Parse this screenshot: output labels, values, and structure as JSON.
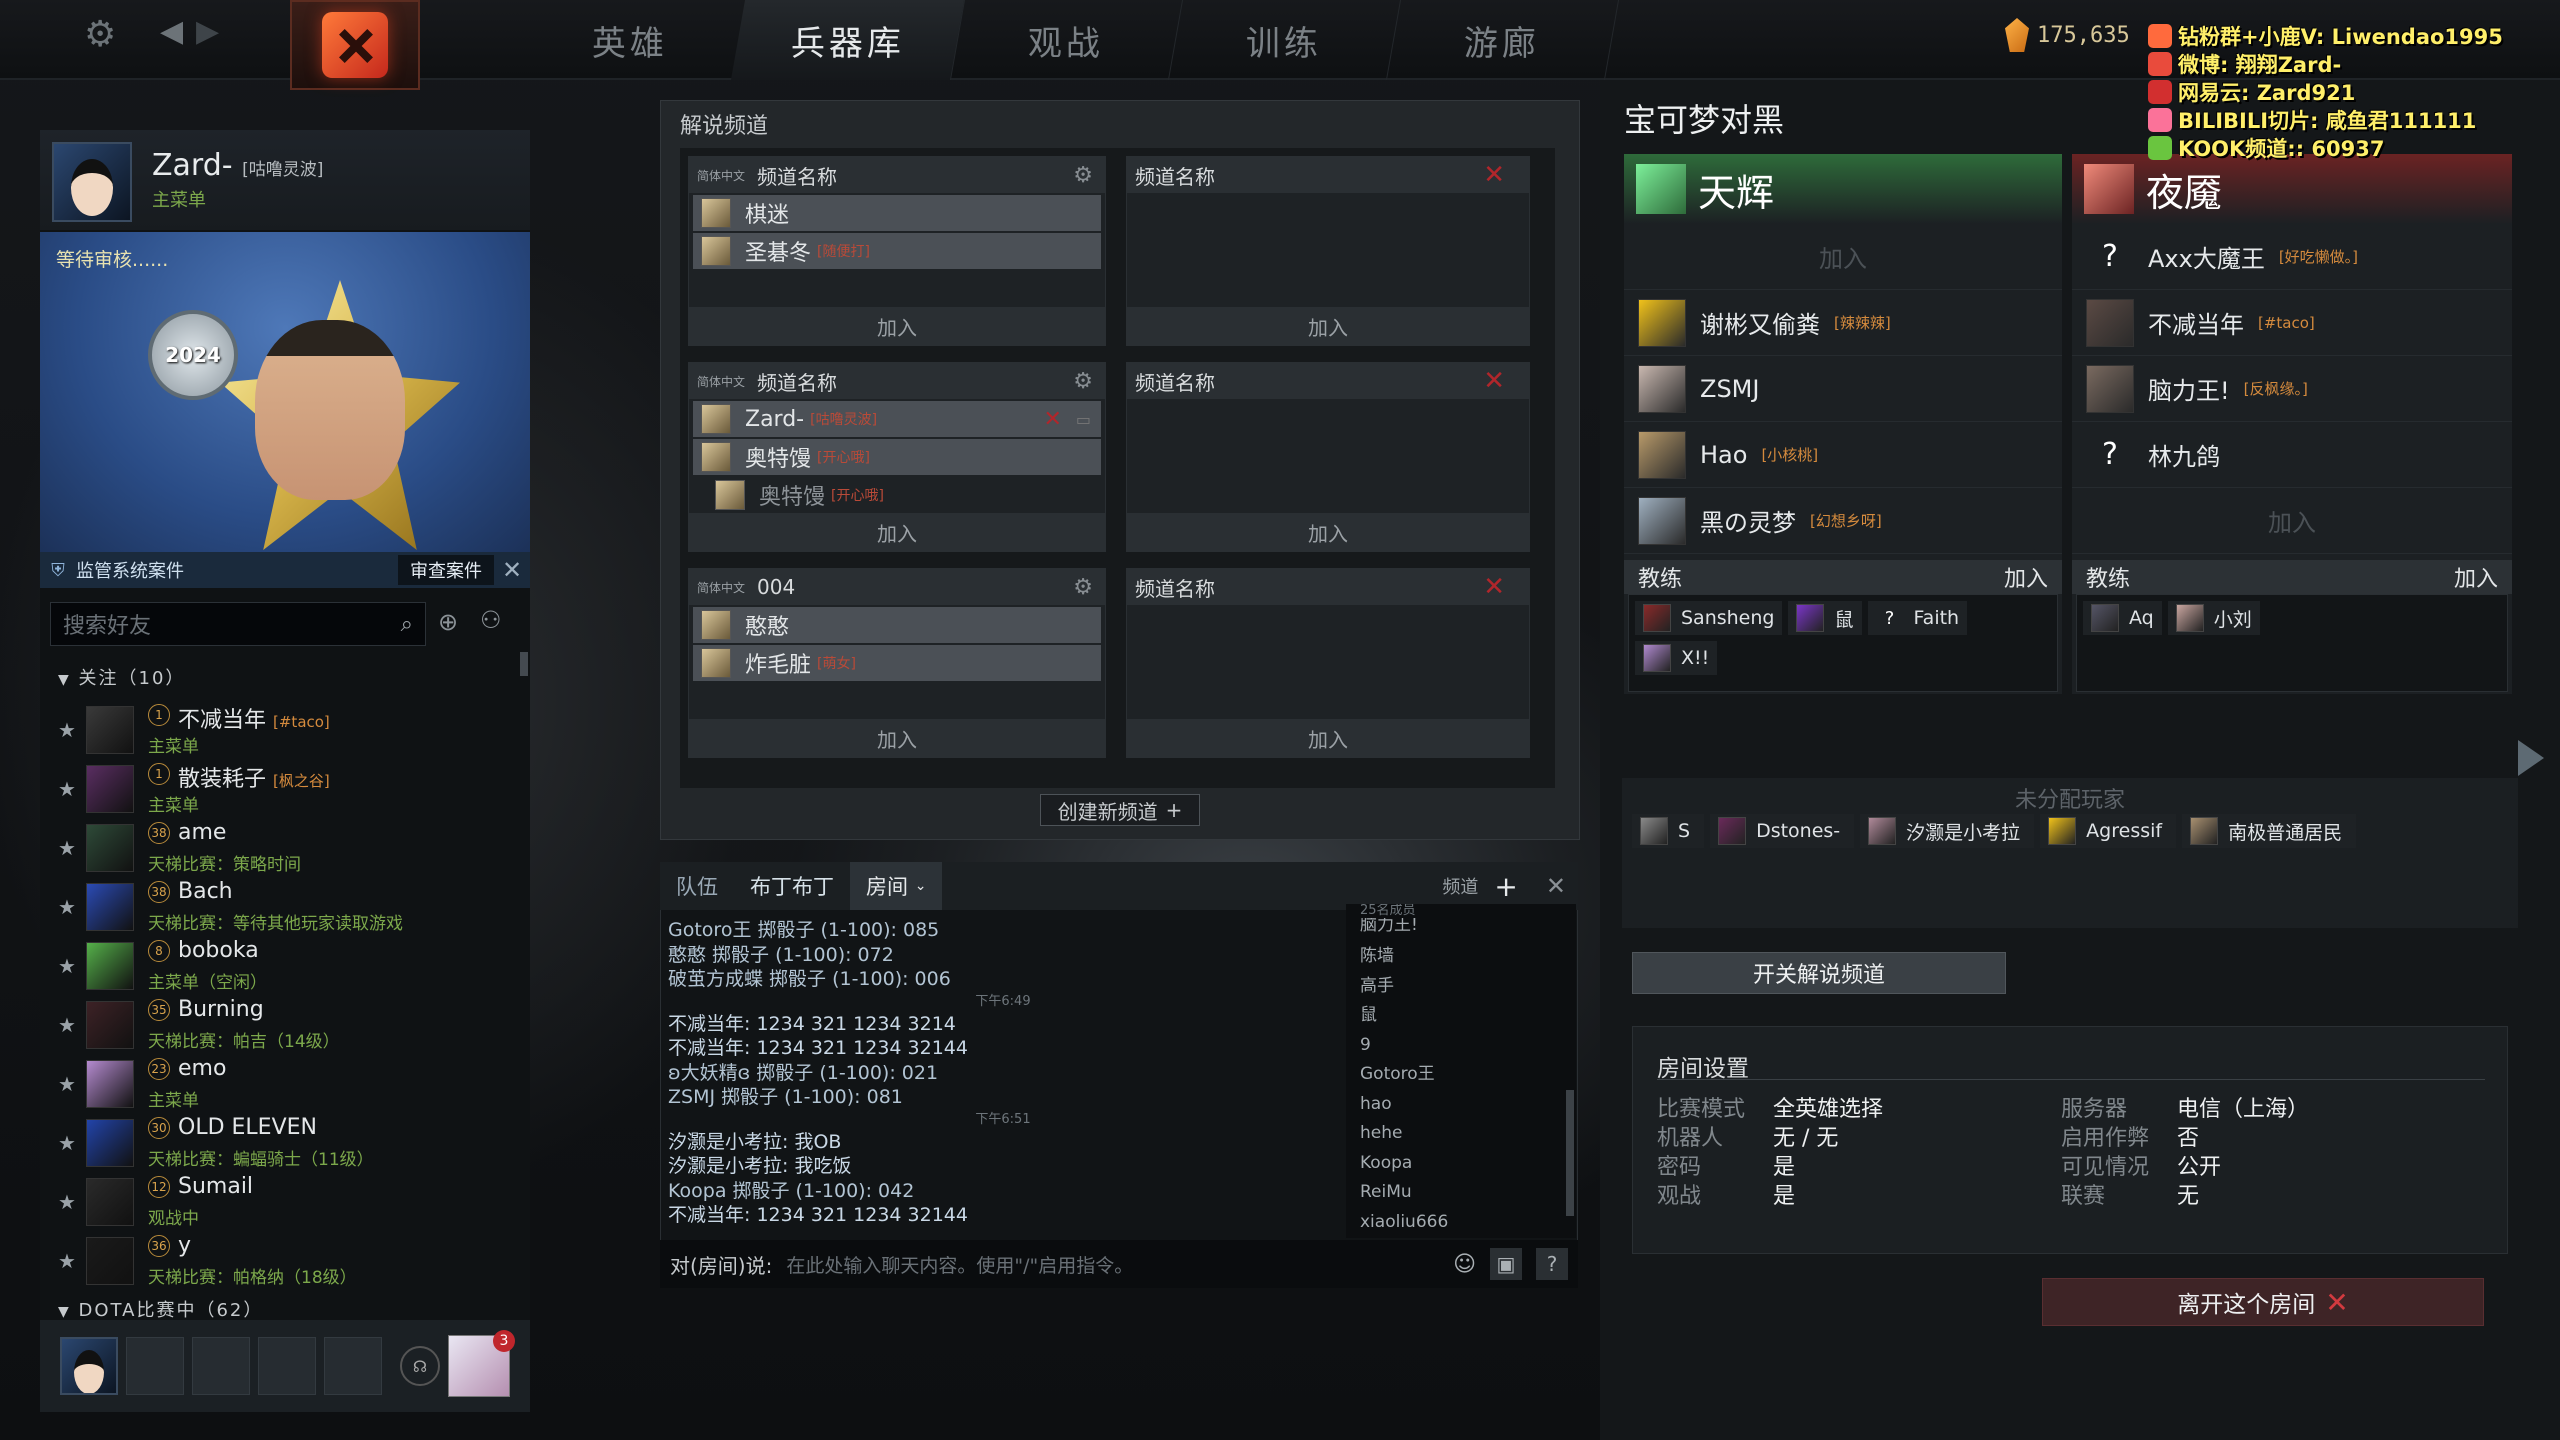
{
  "nav": {
    "tabs": [
      "英雄",
      "兵器库",
      "观战",
      "训练",
      "游廊"
    ],
    "active": "兵器库",
    "currency": "175,635"
  },
  "overlay": {
    "lines": [
      {
        "text": "钻粉群+小鹿V: Liwendao1995",
        "color": "#ff6a3d"
      },
      {
        "text": "微博: 翔翔Zard-",
        "color": "#e94b3c"
      },
      {
        "text": "网易云: Zard921",
        "color": "#d22f2f"
      },
      {
        "text": "BILIBILI切片: 咸鱼君111111",
        "color": "#fb7299"
      },
      {
        "text": "KOOK频道:: 60937",
        "color": "#6ac53f"
      }
    ]
  },
  "profile": {
    "name": "Zard-",
    "tag": "[咕噜灵波]",
    "status": "主菜单",
    "pending": "等待审核......",
    "medal": "2024"
  },
  "monitor": {
    "label": "监管系统案件",
    "button": "审查案件",
    "close": "✕"
  },
  "search": {
    "placeholder": "搜索好友"
  },
  "friends": {
    "group_follow": "关注（10）",
    "group_dota": "DOTA比赛中（62）",
    "list": [
      {
        "lvl": "1",
        "name": "不减当年",
        "tag": "[#taco]",
        "sub": "主菜单",
        "color": "#3a3a3a"
      },
      {
        "lvl": "1",
        "name": "散装耗子",
        "tag": "[枫之谷]",
        "sub": "主菜单",
        "color": "#5a2e62"
      },
      {
        "lvl": "38",
        "name": "ame",
        "tag": "",
        "sub": "天梯比赛：策略时间",
        "color": "#2e4a38"
      },
      {
        "lvl": "38",
        "name": "Bach",
        "tag": "",
        "sub": "天梯比赛：等待其他玩家读取游戏",
        "color": "#2b4bb5"
      },
      {
        "lvl": "8",
        "name": "boboka",
        "tag": "",
        "sub": "主菜单（空闲）",
        "color": "#55b04a"
      },
      {
        "lvl": "35",
        "name": "Burning",
        "tag": "",
        "sub": "天梯比赛：帕吉（14级）",
        "color": "#3d2226"
      },
      {
        "lvl": "23",
        "name": "emo",
        "tag": "",
        "sub": "主菜单",
        "color": "#b58bd0"
      },
      {
        "lvl": "30",
        "name": "OLD ELEVEN",
        "tag": "",
        "sub": "天梯比赛：蝙蝠骑士（11级）",
        "color": "#2244aa"
      },
      {
        "lvl": "12",
        "name": "Sumail",
        "tag": "",
        "sub": "观战中",
        "color": "#2a2a2a"
      },
      {
        "lvl": "36",
        "name": "y",
        "tag": "",
        "sub": "天梯比赛：帕格纳（18级）",
        "color": "#1a1a1a"
      }
    ]
  },
  "party": {
    "badge": "3"
  },
  "channels": {
    "title": "解说频道",
    "create": "创建新频道",
    "lang": "简体中文",
    "name_label": "频道名称",
    "join": "加入",
    "c1": {
      "rows": [
        {
          "name": "棋迷",
          "tag": ""
        },
        {
          "name": "圣碁冬",
          "tag": "[随便打]"
        }
      ]
    },
    "c2": {
      "rows": [
        {
          "name": "Zard-",
          "tag": "[咕噜灵波]"
        },
        {
          "name": "奥特馒",
          "tag": "[开心哦]"
        },
        {
          "name": "奥特馒",
          "tag": "[开心哦]"
        }
      ]
    },
    "c3": {
      "title": "004",
      "rows": [
        {
          "name": "憨憨",
          "tag": ""
        },
        {
          "name": "炸毛脏",
          "tag": "[萌女]"
        }
      ]
    }
  },
  "chat": {
    "tabs": [
      "队伍",
      "布丁布丁",
      "房间"
    ],
    "channel_label": "频道",
    "members_count": "25名成员",
    "members": [
      "脑力王!",
      "陈墙",
      "高手",
      "鼠",
      "9",
      "Gotoro王",
      "hao",
      "hehe",
      "Koopa",
      "ReiMu",
      "xiaoliu666"
    ],
    "log": [
      {
        "t": "Gotoro王 掷骰子 (1-100): 085",
        "c": "sys"
      },
      {
        "t": "憨憨 掷骰子 (1-100): 072",
        "c": "sys"
      },
      {
        "t": "破茧方成蝶 掷骰子 (1-100): 006",
        "c": "sys"
      },
      {
        "t": "下午6:49",
        "c": "ts"
      },
      {
        "t": "不减当年: 1234 321 1234 3214",
        "c": ""
      },
      {
        "t": "不减当年: 1234 321 1234 32144",
        "c": ""
      },
      {
        "t": "ʚ大妖精ɞ 掷骰子 (1-100): 021",
        "c": "sys"
      },
      {
        "t": "ZSMJ 掷骰子 (1-100): 081",
        "c": "sys"
      },
      {
        "t": "下午6:51",
        "c": "ts"
      },
      {
        "t": "汐灏是小考拉: 我OB",
        "c": ""
      },
      {
        "t": "汐灏是小考拉: 我吃饭",
        "c": ""
      },
      {
        "t": "Koopa 掷骰子 (1-100): 042",
        "c": "sys"
      },
      {
        "t": "不减当年: 1234 321 1234 32144",
        "c": ""
      }
    ],
    "input_prefix": "对(房间)说:",
    "input_placeholder": "在此处输入聊天内容。使用\"/\"启用指令。"
  },
  "lobby": {
    "title": "宝可梦对黑",
    "radiant": {
      "name": "天辉",
      "slots": [
        {
          "name": "",
          "tag": "",
          "join": true
        },
        {
          "name": "谢彬又偷粪",
          "tag": "[辣辣辣]",
          "color": "#f1c21a"
        },
        {
          "name": "ZSMJ",
          "tag": "",
          "color": "#c9b8b0"
        },
        {
          "name": "Hao",
          "tag": "[小核桃]",
          "color": "#b89a6a"
        },
        {
          "name": "黑の灵梦",
          "tag": "[幻想乡呀]",
          "color": "#9fb0c0"
        }
      ],
      "coach_label": "教练",
      "coach_join": "加入",
      "coaches": [
        {
          "name": "Sansheng",
          "color": "#8a2a2a"
        },
        {
          "name": "鼠",
          "color": "#7a36c7"
        },
        {
          "name": "Faith",
          "color": "#222"
        },
        {
          "name": "X!!",
          "color": "#b08ad0"
        }
      ]
    },
    "dire": {
      "name": "夜魇",
      "slots": [
        {
          "name": "Axx大魔王",
          "tag": "[好吃懒做。]",
          "color": "#222"
        },
        {
          "name": "不减当年",
          "tag": "[#taco]",
          "color": "#5b4a44"
        },
        {
          "name": "脑力王!",
          "tag": "[反枫缘。]",
          "color": "#7a6a60"
        },
        {
          "name": "林九鸽",
          "tag": "",
          "color": "#222"
        },
        {
          "name": "",
          "tag": "",
          "join": true
        }
      ],
      "coach_label": "教练",
      "coach_join": "加入",
      "coaches": [
        {
          "name": "Aq",
          "color": "#556"
        },
        {
          "name": "小刘",
          "color": "#c9a6a0"
        }
      ]
    },
    "unassigned_label": "未分配玩家",
    "unassigned": [
      {
        "name": "S",
        "color": "#8a8a8a"
      },
      {
        "name": "Dstones-",
        "color": "#6a2a5a"
      },
      {
        "name": "汐灏是小考拉",
        "color": "#b08a9a"
      },
      {
        "name": "Agressif",
        "color": "#f1c21a"
      },
      {
        "name": "南极普通居民",
        "color": "#a89070"
      }
    ],
    "toggle_button": "开关解说频道",
    "settings": {
      "title": "房间设置",
      "left": [
        {
          "k": "比赛模式",
          "v": "全英雄选择"
        },
        {
          "k": "机器人",
          "v": "无 / 无"
        },
        {
          "k": "密码",
          "v": "是"
        },
        {
          "k": "观战",
          "v": "是"
        }
      ],
      "right": [
        {
          "k": "服务器",
          "v": "电信（上海）"
        },
        {
          "k": "启用作弊",
          "v": "否"
        },
        {
          "k": "可见情况",
          "v": "公开"
        },
        {
          "k": "联赛",
          "v": "无"
        }
      ]
    },
    "leave_button": "离开这个房间"
  }
}
